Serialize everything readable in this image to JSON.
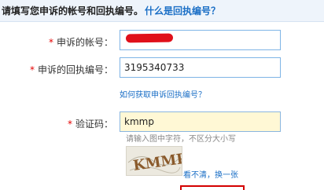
{
  "header": {
    "title": "请填写您申诉的帐号和回执编号。",
    "help_link": "什么是回执编号？"
  },
  "form": {
    "required_mark": "*",
    "account": {
      "label": "申诉的帐号：",
      "value": ""
    },
    "receipt": {
      "label": "申诉的回执编号：",
      "value": "3195340733"
    },
    "receipt_help_link": "如何获取申诉回执编号？",
    "captcha": {
      "label": "验证码：",
      "value": "kmmp",
      "hint": "请输入图中字符，不区分大小写",
      "image_text": "KMMP",
      "refresh_link": "看不清，换一张"
    }
  },
  "colors": {
    "link": "#1b6fc6",
    "required": "#e40000",
    "redaction": "#e0101a",
    "active_field_bg": "#fff8d5",
    "header_bg": "#eef4fb"
  }
}
